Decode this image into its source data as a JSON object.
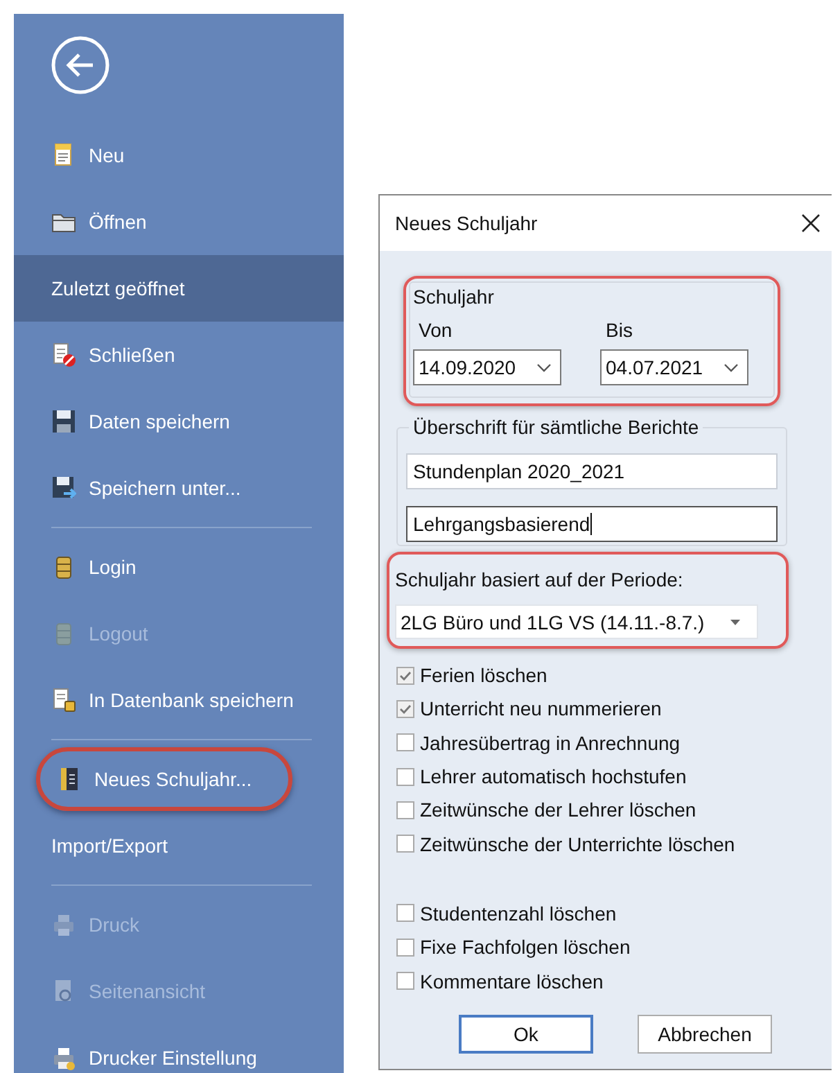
{
  "backstage": {
    "items": [
      {
        "kind": "command",
        "label": "Neu",
        "selected": false,
        "disabled": false,
        "highlighted": false
      },
      {
        "kind": "command",
        "label": "Öffnen",
        "selected": false,
        "disabled": false,
        "highlighted": false
      },
      {
        "kind": "section",
        "label": "Zuletzt geöffnet",
        "selected": true,
        "disabled": false,
        "highlighted": false
      },
      {
        "kind": "command",
        "label": "Schließen",
        "selected": false,
        "disabled": false,
        "highlighted": false
      },
      {
        "kind": "command",
        "label": "Daten speichern",
        "selected": false,
        "disabled": false,
        "highlighted": false
      },
      {
        "kind": "command",
        "label": "Speichern unter...",
        "selected": false,
        "disabled": false,
        "highlighted": false
      },
      {
        "kind": "separator"
      },
      {
        "kind": "command",
        "label": "Login",
        "selected": false,
        "disabled": false,
        "highlighted": false
      },
      {
        "kind": "command",
        "label": "Logout",
        "selected": false,
        "disabled": true,
        "highlighted": false
      },
      {
        "kind": "command",
        "label": "In Datenbank speichern",
        "selected": false,
        "disabled": false,
        "highlighted": false
      },
      {
        "kind": "separator"
      },
      {
        "kind": "command",
        "label": "Neues Schuljahr...",
        "selected": false,
        "disabled": false,
        "highlighted": true
      },
      {
        "kind": "section",
        "label": "Import/Export",
        "selected": false,
        "disabled": false,
        "highlighted": false
      },
      {
        "kind": "separator"
      },
      {
        "kind": "command",
        "label": "Druck",
        "selected": false,
        "disabled": true,
        "highlighted": false
      },
      {
        "kind": "command",
        "label": "Seitenansicht",
        "selected": false,
        "disabled": true,
        "highlighted": false
      },
      {
        "kind": "command",
        "label": "Drucker Einstellung",
        "selected": false,
        "disabled": false,
        "highlighted": false
      }
    ]
  },
  "dialog": {
    "title": "Neues Schuljahr",
    "school_year": {
      "legend": "Schuljahr",
      "highlighted": true,
      "from": {
        "label": "Von",
        "value": "14.09.2020"
      },
      "to": {
        "label": "Bis",
        "value": "04.07.2021"
      }
    },
    "report_heading": {
      "legend": "Überschrift für sämtliche Berichte",
      "fields": [
        {
          "value": "Stundenplan 2020_2021",
          "focused": false
        },
        {
          "value": "Lehrgangsbasierend",
          "focused": true
        }
      ]
    },
    "period": {
      "label": "Schuljahr basiert auf der Periode:",
      "value": "2LG Büro und 1LG VS (14.11.-8.7.)",
      "highlighted": true
    },
    "options": [
      {
        "label": "Ferien löschen",
        "checked": true
      },
      {
        "label": "Unterricht neu nummerieren",
        "checked": true
      },
      {
        "label": "Jahresübertrag in Anrechnung",
        "checked": false
      },
      {
        "label": "Lehrer automatisch hochstufen",
        "checked": false
      },
      {
        "label": "Zeitwünsche der Lehrer löschen",
        "checked": false
      },
      {
        "label": "Zeitwünsche der Unterrichte löschen",
        "checked": false
      }
    ],
    "reset_options": [
      {
        "label": "Studentenzahl löschen",
        "checked": false
      },
      {
        "label": "Fixe Fachfolgen löschen",
        "checked": false
      },
      {
        "label": "Kommentare löschen",
        "checked": false
      }
    ],
    "buttons": [
      {
        "label": "Ok",
        "default": true
      },
      {
        "label": "Abbrechen",
        "default": false
      }
    ]
  }
}
